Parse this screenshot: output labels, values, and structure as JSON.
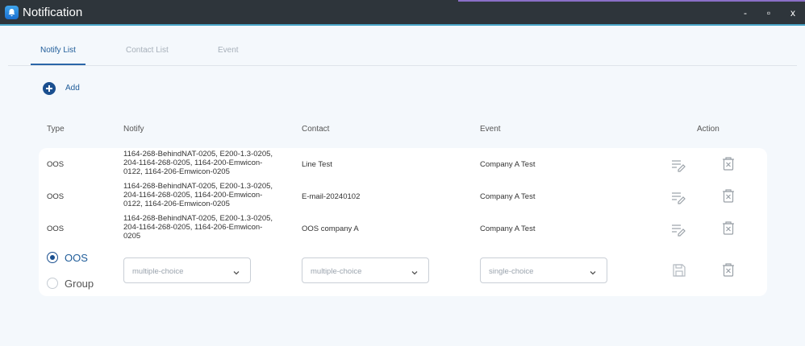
{
  "window": {
    "title": "Notification",
    "minimize": "-",
    "maximize": "▫",
    "close": "x"
  },
  "tabs": [
    "Notify List",
    "Contact List",
    "Event"
  ],
  "add_label": "Add",
  "columns": [
    "Type",
    "Notify",
    "Contact",
    "Event",
    "Action"
  ],
  "rows": [
    {
      "type": "OOS",
      "notify_lines": [
        "1164-268-BehindNAT-0205, E200-1.3-0205,",
        "204-1164-268-0205, 1164-200-Emwicon-",
        "0122, 1164-206-Emwicon-0205"
      ],
      "contact": "Line Test",
      "event": "Company A Test"
    },
    {
      "type": "OOS",
      "notify_lines": [
        "1164-268-BehindNAT-0205, E200-1.3-0205,",
        "204-1164-268-0205, 1164-200-Emwicon-",
        "0122, 1164-206-Emwicon-0205"
      ],
      "contact": "E-mail-20240102",
      "event": "Company A Test"
    },
    {
      "type": "OOS",
      "notify_lines": [
        "1164-268-BehindNAT-0205, E200-1.3-0205,",
        "204-1164-268-0205, 1164-206-Emwicon-",
        "0205"
      ],
      "contact": "OOS company A",
      "event": "Company A Test"
    }
  ],
  "new_row": {
    "type_options": [
      "OOS",
      "Group"
    ],
    "selected_type": "OOS",
    "notify_placeholder": "multiple-choice",
    "contact_placeholder": "multiple-choice",
    "event_placeholder": "single-choice"
  },
  "colors": {
    "accent": "#1a4f8f",
    "titlebar": "#2e353b"
  }
}
